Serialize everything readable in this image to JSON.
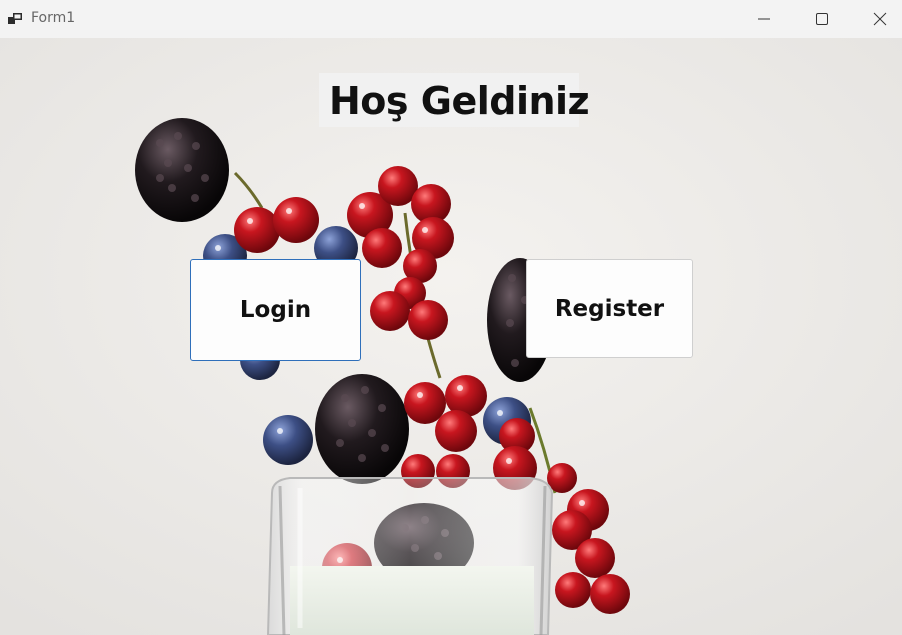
{
  "window": {
    "title": "Form1",
    "app_icon": "winforms-app-icon",
    "controls": [
      "minimize-icon",
      "maximize-icon",
      "close-icon"
    ]
  },
  "main": {
    "welcome_text": "Hoş Geldiniz",
    "login_label": "Login",
    "register_label": "Register"
  },
  "colors": {
    "background": "#ecebe8",
    "focus_border": "#2f6fba",
    "berry_red": "#b3121b",
    "blackberry": "#1a1416"
  }
}
